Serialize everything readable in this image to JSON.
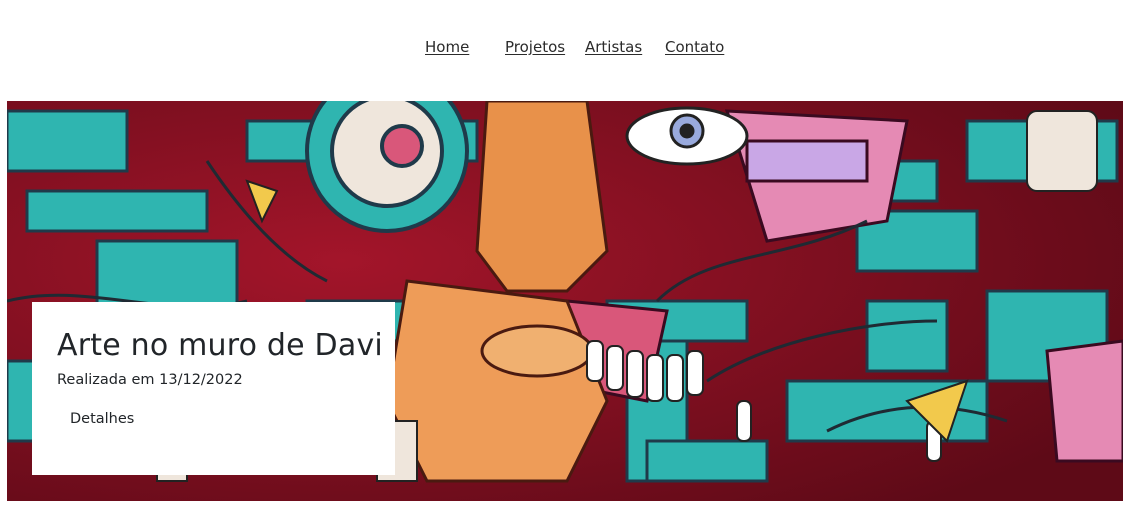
{
  "nav": {
    "items": [
      {
        "label": "Home"
      },
      {
        "label": "Projetos"
      },
      {
        "label": "Artistas"
      },
      {
        "label": "Contato"
      }
    ]
  },
  "hero": {
    "image_icon": "graffiti-mural-image",
    "colors": {
      "base": "#7a0f1e",
      "teal": "#2fb5b0",
      "pink": "#d9577a",
      "orange": "#e8914a",
      "lavender": "#b98fd6",
      "cream": "#efe6dc"
    }
  },
  "card": {
    "title": "Arte no muro de Davi",
    "date": "Realizada em 13/12/2022",
    "details_label": "Detalhes"
  }
}
